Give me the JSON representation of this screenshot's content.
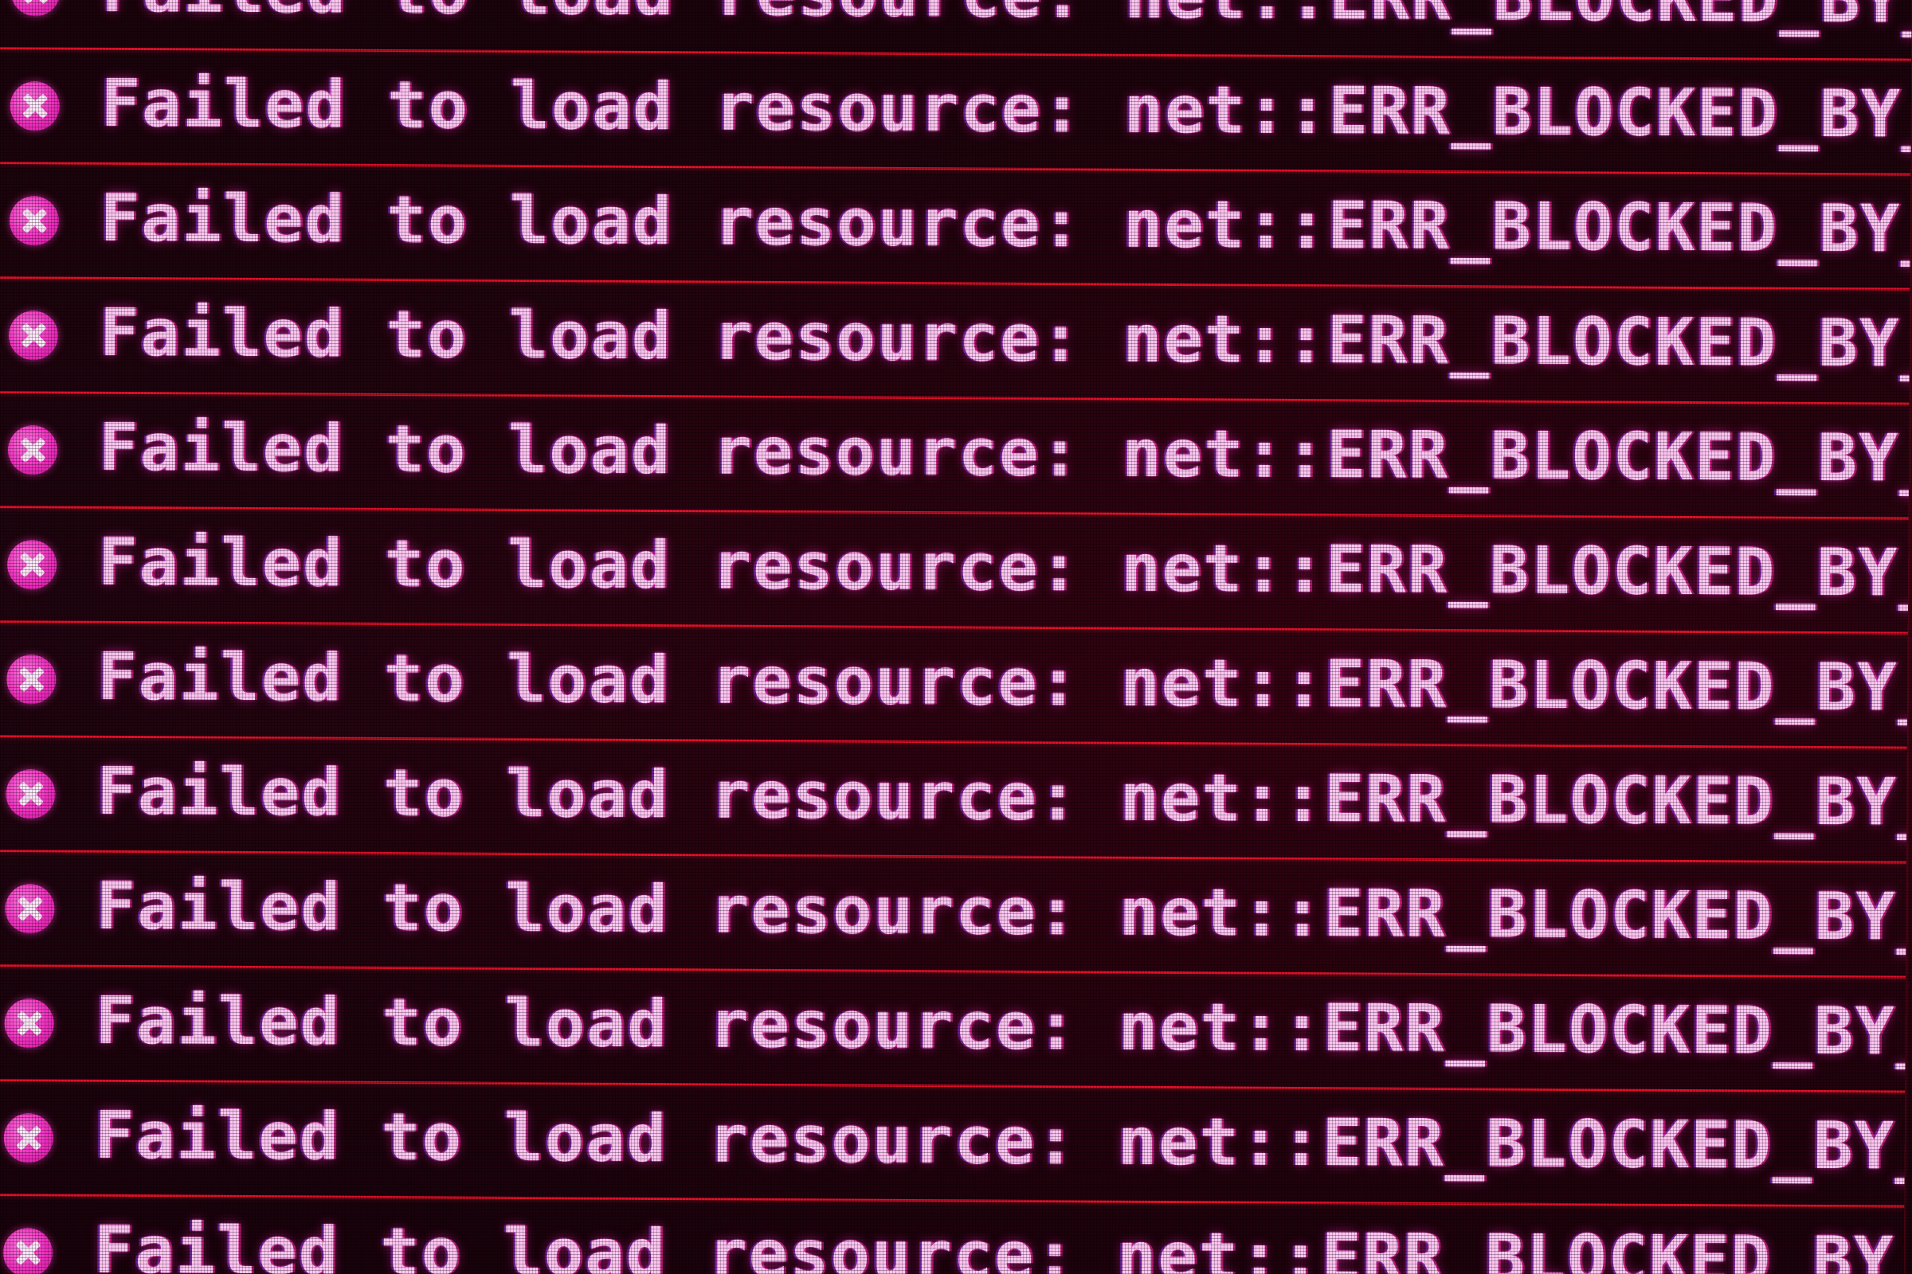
{
  "console": {
    "messages": [
      {
        "level": "error",
        "icon": "error-circle-x-icon",
        "text": "Failed to load resource: net::ERR_BLOCKED_BY_ADBLOCKER"
      },
      {
        "level": "error",
        "icon": "error-circle-x-icon",
        "text": "Failed to load resource: net::ERR_BLOCKED_BY_ADBLOCKER"
      },
      {
        "level": "error",
        "icon": "error-circle-x-icon",
        "text": "Failed to load resource: net::ERR_BLOCKED_BY_ADBLOCKER"
      },
      {
        "level": "error",
        "icon": "error-circle-x-icon",
        "text": "Failed to load resource: net::ERR_BLOCKED_BY_ADBLOCKER"
      },
      {
        "level": "error",
        "icon": "error-circle-x-icon",
        "text": "Failed to load resource: net::ERR_BLOCKED_BY_ADBLOCKER"
      },
      {
        "level": "error",
        "icon": "error-circle-x-icon",
        "text": "Failed to load resource: net::ERR_BLOCKED_BY_ADBLOCKER"
      },
      {
        "level": "error",
        "icon": "error-circle-x-icon",
        "text": "Failed to load resource: net::ERR_BLOCKED_BY_ADBLOCKER"
      },
      {
        "level": "error",
        "icon": "error-circle-x-icon",
        "text": "Failed to load resource: net::ERR_BLOCKED_BY_ADBLOCKER"
      },
      {
        "level": "error",
        "icon": "error-circle-x-icon",
        "text": "Failed to load resource: net::ERR_BLOCKED_BY_ADBLOCKER"
      },
      {
        "level": "error",
        "icon": "error-circle-x-icon",
        "text": "Failed to load resource: net::ERR_BLOCKED_BY_ADBLOCKER"
      },
      {
        "level": "error",
        "icon": "error-circle-x-icon",
        "text": "Failed to load resource: net::ERR_BLOCKED_BY_ADBLOCKER"
      },
      {
        "level": "error",
        "icon": "error-circle-x-icon",
        "text": "Failed to load resource: net::ERR_BLOCKED_BY_ADBLOCKER"
      }
    ]
  },
  "colors": {
    "error_text": "#ffc6f2",
    "error_icon": "#f02fbf",
    "row_divider": "#e0102a",
    "background": "#14040a"
  }
}
